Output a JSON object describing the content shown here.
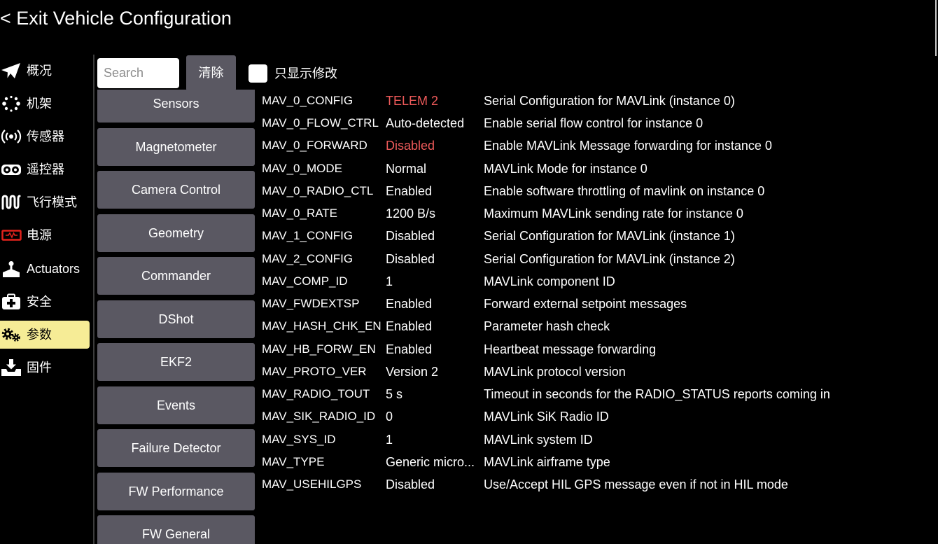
{
  "header": {
    "back_label": "< Exit Vehicle Configuration"
  },
  "sidebar": {
    "items": [
      {
        "label": "概况",
        "icon": "paper-plane-icon",
        "selected": false
      },
      {
        "label": "机架",
        "icon": "airframe-icon",
        "selected": false
      },
      {
        "label": "传感器",
        "icon": "sensors-icon",
        "selected": false
      },
      {
        "label": "遥控器",
        "icon": "radio-controller-icon",
        "selected": false
      },
      {
        "label": "飞行模式",
        "icon": "flight-modes-icon",
        "selected": false
      },
      {
        "label": "电源",
        "icon": "battery-icon",
        "selected": false
      },
      {
        "label": "Actuators",
        "icon": "actuators-icon",
        "selected": false
      },
      {
        "label": "安全",
        "icon": "safety-icon",
        "selected": false
      },
      {
        "label": "参数",
        "icon": "gears-icon",
        "selected": true
      },
      {
        "label": "固件",
        "icon": "firmware-icon",
        "selected": false
      }
    ]
  },
  "toolbar": {
    "search_placeholder": "Search",
    "search_value": "",
    "clear_label": "清除",
    "show_modified_label": "只显示修改",
    "show_modified_checked": false
  },
  "groups": [
    "Sensors",
    "Magnetometer",
    "Camera Control",
    "Geometry",
    "Commander",
    "DShot",
    "EKF2",
    "Events",
    "Failure Detector",
    "FW Performance",
    "FW General"
  ],
  "params": [
    {
      "name": "MAV_0_CONFIG",
      "value": "TELEM 2",
      "description": "Serial Configuration for MAVLink (instance 0)",
      "modified": true
    },
    {
      "name": "MAV_0_FLOW_CTRL",
      "value": "Auto-detected",
      "description": "Enable serial flow control for instance 0",
      "modified": false
    },
    {
      "name": "MAV_0_FORWARD",
      "value": "Disabled",
      "description": "Enable MAVLink Message forwarding for instance 0",
      "modified": true
    },
    {
      "name": "MAV_0_MODE",
      "value": "Normal",
      "description": "MAVLink Mode for instance 0",
      "modified": false
    },
    {
      "name": "MAV_0_RADIO_CTL",
      "value": "Enabled",
      "description": "Enable software throttling of mavlink on instance 0",
      "modified": false
    },
    {
      "name": "MAV_0_RATE",
      "value": "1200 B/s",
      "description": "Maximum MAVLink sending rate for instance 0",
      "modified": false
    },
    {
      "name": "MAV_1_CONFIG",
      "value": "Disabled",
      "description": "Serial Configuration for MAVLink (instance 1)",
      "modified": false
    },
    {
      "name": "MAV_2_CONFIG",
      "value": "Disabled",
      "description": "Serial Configuration for MAVLink (instance 2)",
      "modified": false
    },
    {
      "name": "MAV_COMP_ID",
      "value": "1",
      "description": "MAVLink component ID",
      "modified": false
    },
    {
      "name": "MAV_FWDEXTSP",
      "value": "Enabled",
      "description": "Forward external setpoint messages",
      "modified": false
    },
    {
      "name": "MAV_HASH_CHK_EN",
      "value": "Enabled",
      "description": "Parameter hash check",
      "modified": false
    },
    {
      "name": "MAV_HB_FORW_EN",
      "value": "Enabled",
      "description": "Heartbeat message forwarding",
      "modified": false
    },
    {
      "name": "MAV_PROTO_VER",
      "value": "Version 2",
      "description": "MAVLink protocol version",
      "modified": false
    },
    {
      "name": "MAV_RADIO_TOUT",
      "value": "5 s",
      "description": "Timeout in seconds for the RADIO_STATUS reports coming in",
      "modified": false
    },
    {
      "name": "MAV_SIK_RADIO_ID",
      "value": "0",
      "description": "MAVLink SiK Radio ID",
      "modified": false
    },
    {
      "name": "MAV_SYS_ID",
      "value": "1",
      "description": "MAVLink system ID",
      "modified": false
    },
    {
      "name": "MAV_TYPE",
      "value": "Generic micro...",
      "description": "MAVLink airframe type",
      "modified": false
    },
    {
      "name": "MAV_USEHILGPS",
      "value": "Disabled",
      "description": "Use/Accept HIL GPS message even if not in HIL mode",
      "modified": false
    }
  ],
  "colors": {
    "background": "#000000",
    "button": "#5a5862",
    "selected_item": "#f6ec96",
    "modified_value": "#ee5a5a",
    "battery_icon": "#e3221c"
  }
}
